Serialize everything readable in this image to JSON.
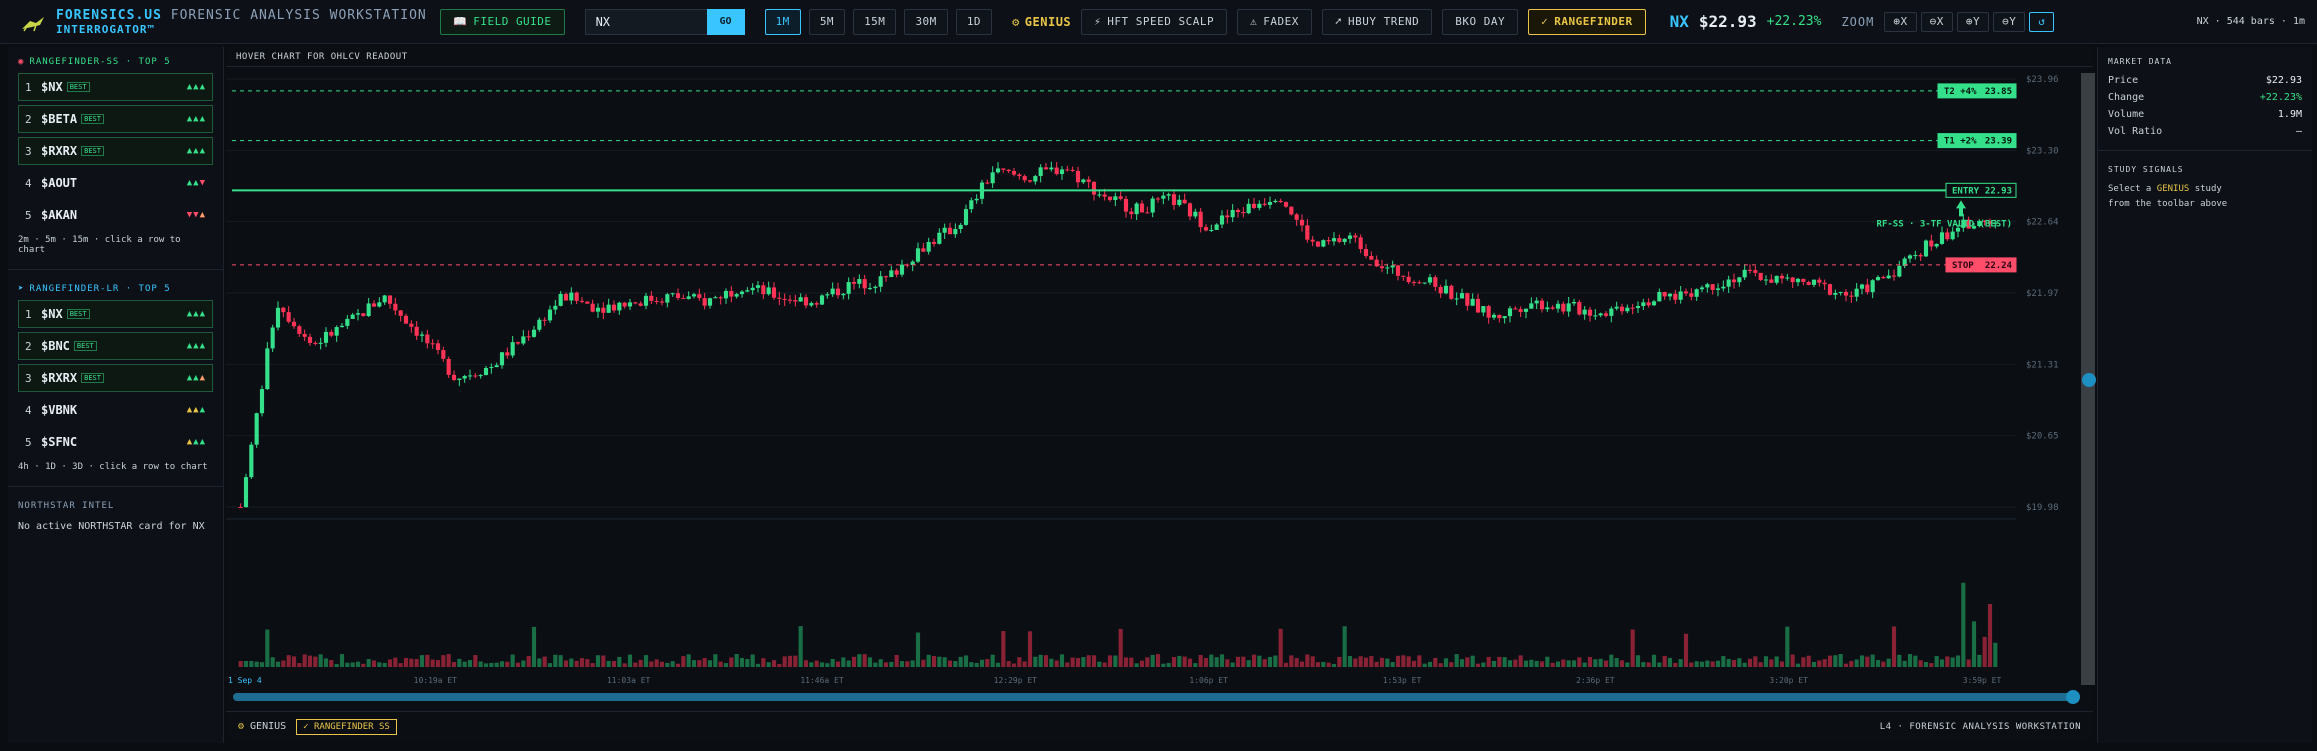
{
  "brand": {
    "name_a": "FORENSICS.US",
    "name_b": "FORENSIC ANALYSIS WORKSTATION",
    "sub": "INTERROGATOR™"
  },
  "toolbar": {
    "field_guide": "FIELD GUIDE",
    "search_value": "NX",
    "go": "GO",
    "timeframes": [
      "1M",
      "5M",
      "15M",
      "30M",
      "1D"
    ],
    "active_timeframe": "1M",
    "genius": "GENIUS",
    "studies": [
      "HFT SPEED SCALP",
      "FADEX",
      "HBUY TREND",
      "BKO DAY",
      "RANGEFINDER"
    ],
    "active_study": "RANGEFINDER",
    "zoom_label": "ZOOM",
    "zoom_buttons": [
      "⊕X",
      "⊖X",
      "⊕Y",
      "⊖Y",
      "↺"
    ],
    "bars_info": "NX · 544 bars · 1m"
  },
  "ticker": {
    "symbol": "NX",
    "price": "$22.93",
    "change": "+22.23%"
  },
  "left": {
    "ss": {
      "title": "RANGEFINDER-SS · TOP 5",
      "rows": [
        {
          "rank": "1",
          "sym": "$NX",
          "badge": "BEST",
          "arrows": [
            [
              "▲",
              "up"
            ],
            [
              "▲",
              "up"
            ],
            [
              "▲",
              "up"
            ]
          ]
        },
        {
          "rank": "2",
          "sym": "$BETA",
          "badge": "BEST",
          "arrows": [
            [
              "▲",
              "up"
            ],
            [
              "▲",
              "up"
            ],
            [
              "▲",
              "up"
            ]
          ]
        },
        {
          "rank": "3",
          "sym": "$RXRX",
          "badge": "BEST",
          "arrows": [
            [
              "▲",
              "up"
            ],
            [
              "▲",
              "up"
            ],
            [
              "▲",
              "up"
            ]
          ]
        },
        {
          "rank": "4",
          "sym": "$AOUT",
          "badge": "",
          "arrows": [
            [
              "▲",
              "up"
            ],
            [
              "▲",
              "up"
            ],
            [
              "▼",
              "dn"
            ]
          ]
        },
        {
          "rank": "5",
          "sym": "$AKAN",
          "badge": "",
          "arrows": [
            [
              "▼",
              "dn"
            ],
            [
              "▼",
              "dn"
            ],
            [
              "▲",
              "ht"
            ]
          ]
        }
      ],
      "hint": "2m · 5m · 15m · click a row to chart"
    },
    "lr": {
      "title": "RANGEFINDER-LR · TOP 5",
      "rows": [
        {
          "rank": "1",
          "sym": "$NX",
          "badge": "BEST",
          "arrows": [
            [
              "▲",
              "up"
            ],
            [
              "▲",
              "up"
            ],
            [
              "▲",
              "up"
            ]
          ]
        },
        {
          "rank": "2",
          "sym": "$BNC",
          "badge": "BEST",
          "arrows": [
            [
              "▲",
              "up"
            ],
            [
              "▲",
              "up"
            ],
            [
              "▲",
              "up"
            ]
          ]
        },
        {
          "rank": "3",
          "sym": "$RXRX",
          "badge": "BEST",
          "arrows": [
            [
              "▲",
              "up"
            ],
            [
              "▲",
              "up"
            ],
            [
              "▲",
              "ht"
            ]
          ]
        },
        {
          "rank": "4",
          "sym": "$VBNK",
          "badge": "",
          "arrows": [
            [
              "▲",
              "yl"
            ],
            [
              "▲",
              "yl"
            ],
            [
              "▲",
              "up"
            ]
          ]
        },
        {
          "rank": "5",
          "sym": "$SFNC",
          "badge": "",
          "arrows": [
            [
              "▲",
              "yl"
            ],
            [
              "▲",
              "up"
            ],
            [
              "▲",
              "up"
            ]
          ]
        }
      ],
      "hint": "4h · 1D · 3D · click a row to chart"
    },
    "intel": {
      "title": "NORTHSTAR INTEL",
      "text": "No active NORTHSTAR card for NX"
    }
  },
  "chart": {
    "header": "HOVER CHART FOR OHLCV READOUT",
    "footer_genius": "GENIUS",
    "footer_rf": "✓ RANGEFINDER SS",
    "footer_ws": "L4 · FORENSIC ANALYSIS WORKSTATION"
  },
  "chart_data": {
    "type": "candlestick",
    "y_ticks": [
      "$23.96",
      "$23.30",
      "$22.64",
      "$21.97",
      "$21.31",
      "$20.65",
      "$19.98"
    ],
    "ylim": [
      20.0,
      23.96
    ],
    "x_ticks": [
      "1 Sep 4",
      "10:19a ET",
      "11:03a ET",
      "11:46a ET",
      "12:29p ET",
      "1:06p ET",
      "1:53p ET",
      "2:36p ET",
      "3:20p ET",
      "3:59p ET"
    ],
    "levels": [
      {
        "label": "T2 +4%",
        "value": 23.85,
        "value_text": "23.85",
        "color": "#35e08a"
      },
      {
        "label": "T1 +2%",
        "value": 23.39,
        "value_text": "23.39",
        "color": "#35e08a"
      },
      {
        "label": "ENTRY",
        "value": 22.93,
        "value_text": "22.93",
        "color": "#35e08a"
      },
      {
        "label": "STOP",
        "value": 22.24,
        "value_text": "22.24",
        "color": "#ff4d6a"
      }
    ],
    "signal_text": "RF-SS · 3-TF VALID (BEST)",
    "price_path": [
      20.0,
      21.9,
      21.5,
      21.7,
      21.95,
      21.6,
      21.2,
      21.3,
      21.6,
      21.95,
      21.85,
      21.9,
      21.95,
      21.9,
      22.05,
      21.95,
      21.9,
      22.05,
      22.1,
      22.4,
      22.6,
      23.1,
      23.05,
      23.15,
      22.9,
      22.75,
      22.85,
      22.6,
      22.75,
      22.9,
      22.4,
      22.5,
      22.2,
      22.1,
      21.95,
      21.75,
      21.9,
      21.85,
      21.8,
      21.9,
      21.95,
      22.05,
      22.15,
      22.1,
      22.05,
      21.95,
      22.15,
      22.4,
      22.6,
      22.65
    ]
  },
  "right": {
    "market_title": "MARKET DATA",
    "kv": [
      {
        "k": "Price",
        "v": "$22.93",
        "g": false
      },
      {
        "k": "Change",
        "v": "+22.23%",
        "g": true
      },
      {
        "k": "Volume",
        "v": "1.9M",
        "g": false
      },
      {
        "k": "Vol Ratio",
        "v": "—",
        "g": false
      }
    ],
    "signals_title": "STUDY SIGNALS",
    "signals_text_a": "Select a",
    "signals_text_genius": "GENIUS",
    "signals_text_b": "study",
    "signals_text_c": "from the toolbar above"
  },
  "colors": {
    "accent": "#39c5ff",
    "up": "#35e08a",
    "down": "#ff4d6a",
    "gold": "#e8c547"
  }
}
